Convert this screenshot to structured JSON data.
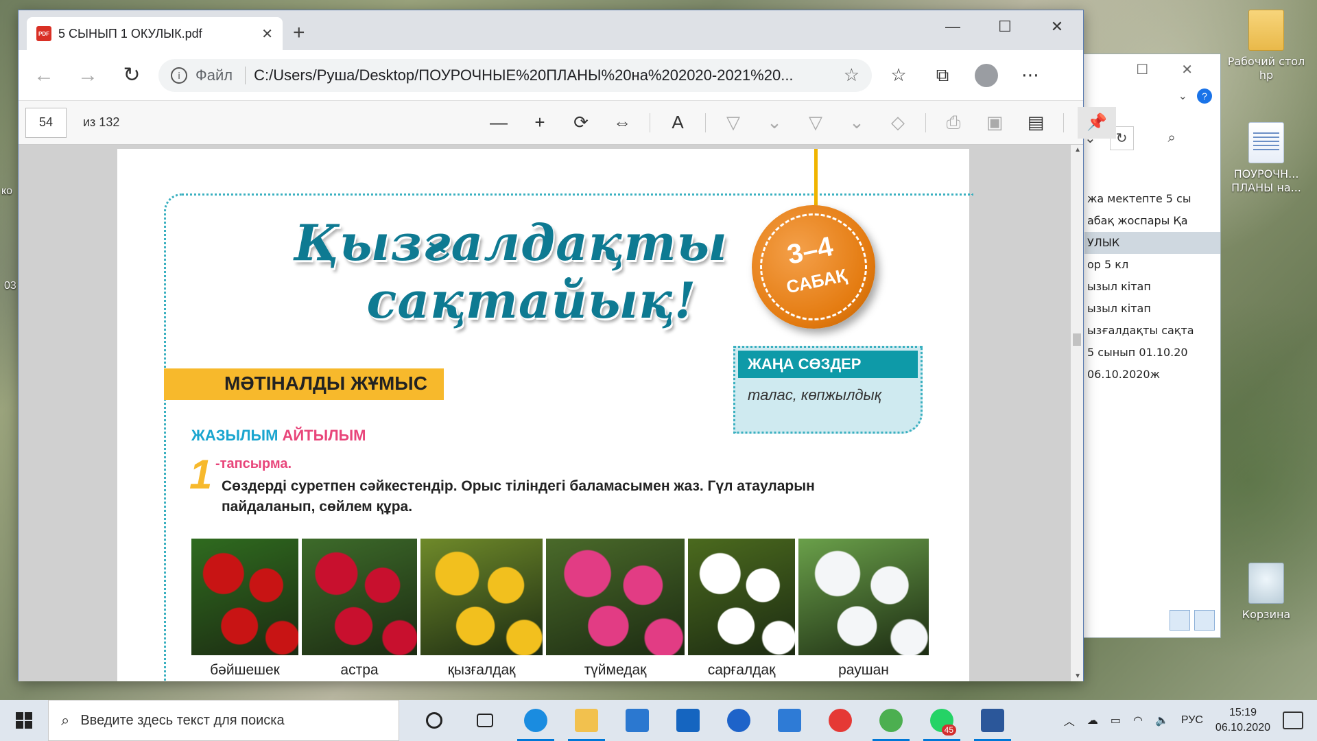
{
  "desktop": {
    "icons": [
      {
        "label": "Рабочий стол hp",
        "icon": "folder-icon"
      },
      {
        "label": "ПОУРОЧН... ПЛАНЫ на...",
        "icon": "word-doc-icon"
      },
      {
        "label": "Корзина",
        "icon": "recycle-bin-icon"
      }
    ],
    "left_edge_texts": [
      "ко",
      "03"
    ]
  },
  "explorer": {
    "rows": [
      "жа мектепте 5 сы",
      "абақ жоспары Қа",
      "УЛЫК",
      "ор 5 кл",
      "ызыл кітап",
      "ызыл кітап",
      "ызғалдақты сақта",
      "5 сынып 01.10.20",
      "06.10.2020ж"
    ],
    "selected_index": 2
  },
  "browser": {
    "tab_title": "5 СЫНЫП 1 ОКУЛЫК.pdf",
    "omnibox_scheme": "Файл",
    "omnibox_url": "C:/Users/Руша/Desktop/ПОУРОЧНЫЕ%20ПЛАНЫ%20на%202020-2021%20...",
    "page_number": "54",
    "page_count": "из 132",
    "zoom_percent": null
  },
  "pdf_page": {
    "title_line1": "Қызғалдақты",
    "title_line2": "сақтайық!",
    "badge_number": "3–4",
    "badge_label": "САБАҚ",
    "section_title": "МӘТІНАЛДЫ ЖҰМЫС",
    "new_words_title": "ЖАҢА СӨЗДЕР",
    "new_words_body": "талас, көпжылдық",
    "skill_a": "ЖАЗЫЛЫМ",
    "skill_b": "АЙТЫЛЫМ",
    "task_number": "1",
    "task_label": "-тапсырма.",
    "task_text": "Сөздерді суретпен сәйкестендір. Орыс тіліндегі баламасымен жаз. Гүл атауларын пайдаланып, сөйлем құра.",
    "flowers": [
      {
        "caption": "бәйшешек",
        "colors": [
          "#c81414",
          "#2f6b1f"
        ]
      },
      {
        "caption": "астра",
        "colors": [
          "#c8102e",
          "#3d6b2a"
        ]
      },
      {
        "caption": "қызғалдақ",
        "colors": [
          "#f2c01e",
          "#6f8a2a"
        ]
      },
      {
        "caption": "түймедақ",
        "colors": [
          "#e23c84",
          "#4a6a2a"
        ]
      },
      {
        "caption": "сарғалдақ",
        "colors": [
          "#ffffff",
          "#4b6a1e"
        ]
      },
      {
        "caption": "раушан",
        "colors": [
          "#f4f6f8",
          "#6aa04a"
        ]
      }
    ]
  },
  "taskbar": {
    "search_placeholder": "Введите здесь текст для поиска",
    "apps": [
      "cortana-icon",
      "task-view-icon",
      "edge-icon",
      "file-explorer-icon",
      "mail-icon",
      "tablet-icon",
      "u-app-icon",
      "store-icon",
      "yandex-icon",
      "chrome-icon",
      "whatsapp-icon",
      "word-icon"
    ],
    "whatsapp_badge": "45",
    "lang": "РУС",
    "time": "15:19",
    "date": "06.10.2020"
  },
  "colors": {
    "accent": "#0078d7",
    "title_teal": "#0e7a92",
    "section_yellow": "#f7b92c",
    "badge_orange": "#e47b10",
    "pink": "#e8457a",
    "cyan": "#1aa5cf"
  }
}
